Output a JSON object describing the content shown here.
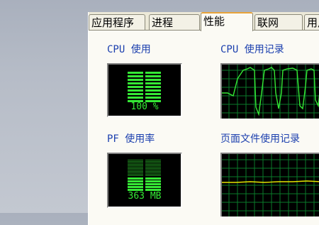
{
  "tabs": [
    {
      "label": "应用程序",
      "active": false
    },
    {
      "label": "进程",
      "active": false
    },
    {
      "label": "性能",
      "active": true
    },
    {
      "label": "联网",
      "active": false
    },
    {
      "label": "用户",
      "active": false
    }
  ],
  "cpu": {
    "title": "CPU 使用",
    "value": "100 %",
    "usage_fraction": 1.0
  },
  "cpu_history": {
    "title": "CPU 使用记录"
  },
  "pf": {
    "title": "PF 使用率",
    "value": "363 MB"
  },
  "pf_history": {
    "title": "页面文件使用记录"
  },
  "colors": {
    "graph_green": "#35e835",
    "grid_green": "#0a7a2a",
    "line_yellow": "#e5e500",
    "title_blue": "#1b3fae",
    "active_tab_accent": "#e8a33a"
  }
}
